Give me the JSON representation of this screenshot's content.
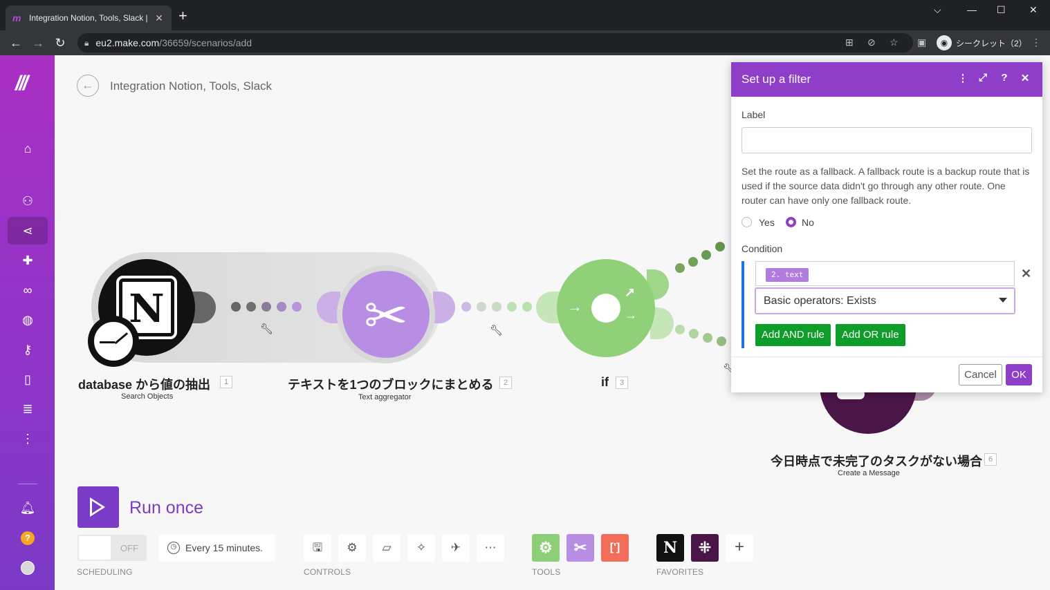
{
  "browser": {
    "tab_title": "Integration Notion, Tools, Slack |",
    "tab_favicon": "make-logo-icon",
    "url_host": "eu2.make.com",
    "url_path": "/36659/scenarios/add",
    "profile_label": "シークレット（2）",
    "win_minimize": "—",
    "win_maximize": "☐",
    "win_close": "✕",
    "new_tab": "+"
  },
  "scenario": {
    "title": "Integration Notion, Tools, Slack"
  },
  "modules": [
    {
      "title": "database から値の抽出",
      "subtitle": "Search Objects",
      "number": "1",
      "app": "notion",
      "color": "#111111"
    },
    {
      "title": "テキストを1つのブロックにまとめる",
      "subtitle": "Text aggregator",
      "number": "2",
      "app": "tools",
      "color": "#b78ee4"
    },
    {
      "title": "if",
      "subtitle": "",
      "number": "3",
      "app": "router",
      "color": "#8fd078"
    },
    {
      "title": "今日時点で未完了のタスクがない場合",
      "subtitle": "Create a Message",
      "number": "6",
      "app": "slack",
      "color": "#4a1547"
    }
  ],
  "toolbar": {
    "run_label": "Run once",
    "toggle_state": "OFF",
    "schedule_text": "Every 15 minutes.",
    "scheduling_label": "SCHEDULING",
    "controls_label": "CONTROLS",
    "tools_label": "TOOLS",
    "favorites_label": "FAVORITES",
    "controls": [
      "save-icon",
      "settings-icon",
      "notes-icon",
      "auto-align-icon",
      "explain-flow-icon",
      "more-icon"
    ],
    "tools": [
      "flow-control-icon",
      "tools-icon",
      "text-parser-icon"
    ],
    "favorites": [
      "notion-icon",
      "slack-icon"
    ]
  },
  "filter_dialog": {
    "title": "Set up a filter",
    "label_label": "Label",
    "label_value": "",
    "fallback_help": "Set the route as a fallback. A fallback route is a backup route that is used if the source data didn't go through any other route. One router can have only one fallback route.",
    "fallback_yes": "Yes",
    "fallback_no": "No",
    "fallback_selected": "No",
    "condition_label": "Condition",
    "condition_value_pill": "2. text",
    "operator": "Basic operators: Exists",
    "add_and": "Add AND rule",
    "add_or": "Add OR rule",
    "cancel": "Cancel",
    "ok": "OK"
  },
  "colors": {
    "accent": "#8e3ec9",
    "green_button": "#0f9d2a",
    "router_green": "#8fd078"
  }
}
